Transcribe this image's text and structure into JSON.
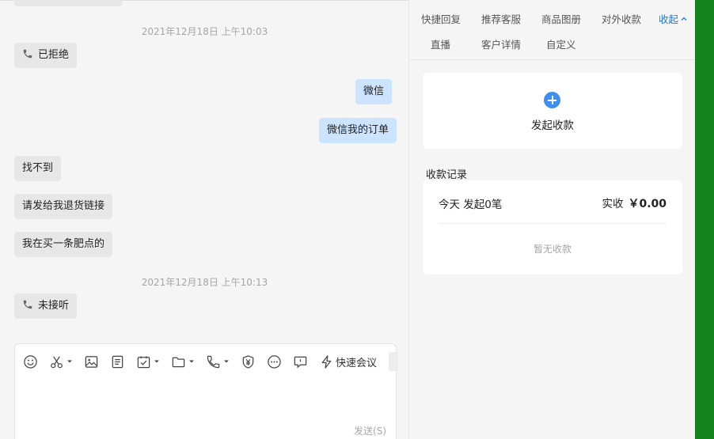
{
  "chat": {
    "timestamps": [
      "2021年12月18日 上午10:03",
      "2021年12月18日 上午10:13"
    ],
    "messages": [
      {
        "dir": "in",
        "type": "call",
        "icon": "phone-icon",
        "text": "已拒绝"
      },
      {
        "dir": "out",
        "type": "text",
        "text": "微信"
      },
      {
        "dir": "out",
        "type": "text",
        "text": "微信我的订单"
      },
      {
        "dir": "in",
        "type": "text",
        "text": "找不到"
      },
      {
        "dir": "in",
        "type": "text",
        "text": "请发给我退货链接"
      },
      {
        "dir": "in",
        "type": "text",
        "text": "我在买一条肥点的"
      },
      {
        "dir": "in",
        "type": "call",
        "icon": "phone-icon",
        "text": "未接听"
      }
    ]
  },
  "composer": {
    "tools": [
      "emoji-icon",
      "scissors-icon",
      "image-icon",
      "document-icon",
      "calendar-check-icon",
      "folder-icon",
      "phone-icon",
      "yuan-shield-icon",
      "more-icon",
      "comment-icon",
      "lightning-icon"
    ],
    "quick_meeting_label": "快速会议",
    "send_label": "发送(S)"
  },
  "side": {
    "tabs": [
      "快捷回复",
      "推荐客服",
      "商品图册",
      "对外收款",
      "直播",
      "客户详情",
      "自定义"
    ],
    "collapse_label": "收起",
    "start_payment_label": "发起收款",
    "records_title": "收款记录",
    "today_label": "今天 发起0笔",
    "received_label": "实收",
    "received_amount": "￥0.00",
    "empty_label": "暂无收款"
  },
  "colors": {
    "outgoing_bubble": "#cce4ff",
    "incoming_bubble": "#e7e7e7",
    "accent": "#3f8ff0",
    "link": "#1e79d8",
    "edge_bar": "#14831d"
  }
}
